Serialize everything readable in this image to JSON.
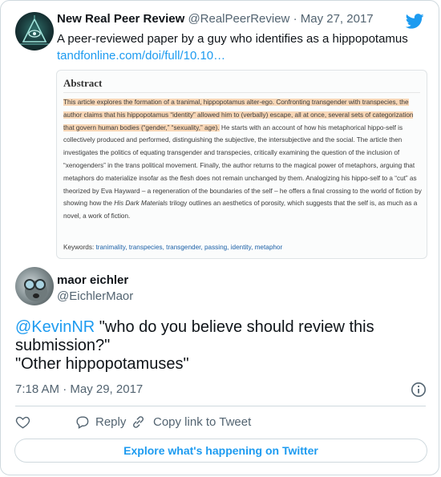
{
  "quoted_tweet": {
    "display_name": "New Real Peer Review",
    "handle": "@RealPeerReview",
    "separator": "·",
    "date": "May 27, 2017",
    "text": "A peer-reviewed paper by a guy who identifies as a hippopotamus",
    "link": "tandfonline.com/doi/full/10.10…"
  },
  "abstract_image": {
    "title": "Abstract",
    "highlighted_text": "This article explores the formation of a tranimal, hippopotamus alter-ego. Confronting transgender with transpecies, the author claims that his hippopotamus “identity” allowed him to (verbally) escape, all at once, several sets of categorization that govern human bodies (“gender,” “sexuality,” age).",
    "text_a": " He starts with an account of how his metaphorical hippo-self is collectively produced and performed, distinguishing the subjective, the intersubjective and the social. The article then investigates the politics of equating transgender and transpecies, critically examining the question of the inclusion of “xenogenders” in the trans political movement. Finally, the author returns to the magical power of metaphors, arguing that metaphors do materialize insofar as the flesh does not remain unchanged by them. Analogizing his hippo-self to a “cut” as theorized by Eva Hayward – a regeneration of the boundaries of the self – he offers a final crossing to the world of fiction by showing how the ",
    "italic_text": "His Dark Materials",
    "text_b": " trilogy outlines an aesthetics of porosity, which suggests that the self is, as much as a novel, a work of fiction.",
    "keywords_label": "Keywords: ",
    "keywords": "tranimality, transpecies, transgender, passing, identity, metaphor",
    "highlight_color": "#f8d7b7"
  },
  "main_tweet": {
    "display_name": "maor eichler",
    "handle": "@EichlerMaor",
    "mention": "@KevinNR",
    "text_line1_rest": " \"who do you believe should review this",
    "text_line2": "submission?\"",
    "text_line3": "\"Other hippopotamuses\"",
    "timestamp": "7:18 AM · May 29, 2017"
  },
  "actions": {
    "like_icon": "heart-icon",
    "reply_label": "Reply",
    "copy_label": "Copy link to Tweet"
  },
  "explore_label": "Explore what's happening on Twitter",
  "colors": {
    "link": "#1d9bf0",
    "text": "#0f1419",
    "secondary": "#536471",
    "border": "#cfd9de"
  }
}
